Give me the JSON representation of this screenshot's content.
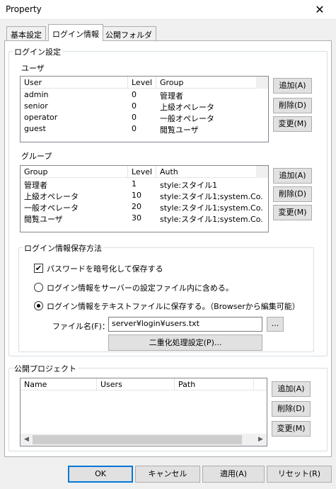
{
  "window": {
    "title": "Property",
    "close_glyph": "✕"
  },
  "tabs": [
    {
      "label": "基本設定"
    },
    {
      "label": "ログイン情報"
    },
    {
      "label": "公開フォルダ"
    }
  ],
  "login_settings": {
    "label": "ログイン設定",
    "users": {
      "label": "ユーザ",
      "columns": [
        "User",
        "Level",
        "Group"
      ],
      "rows": [
        [
          "admin",
          "0",
          "管理者"
        ],
        [
          "senior",
          "0",
          "上級オペレータ"
        ],
        [
          "operator",
          "0",
          "一般オペレータ"
        ],
        [
          "guest",
          "0",
          "閲覧ユーザ"
        ]
      ],
      "buttons": {
        "add": "追加(A)",
        "delete": "削除(D)",
        "change": "変更(M)"
      }
    },
    "groups": {
      "label": "グループ",
      "columns": [
        "Group",
        "Level",
        "Auth"
      ],
      "rows": [
        [
          "管理者",
          "1",
          "style:スタイル1"
        ],
        [
          "上級オペレータ",
          "10",
          "style:スタイル1;system.Co..."
        ],
        [
          "一般オペレータ",
          "20",
          "style:スタイル1;system.Co..."
        ],
        [
          "閲覧ユーザ",
          "30",
          "style:スタイル1;system.Co..."
        ]
      ],
      "buttons": {
        "add": "追加(A)",
        "delete": "削除(D)",
        "change": "変更(M)"
      }
    },
    "save_method": {
      "label": "ログイン情報保存方法",
      "encrypt_label": "パスワードを暗号化して保存する",
      "encrypt_checked": true,
      "option_server": "ログイン情報をサーバーの設定ファイル内に含める。",
      "option_textfile": "ログイン情報をテキストファイルに保存する。（Browserから編集可能）",
      "selected": "textfile",
      "filename_label": "ファイル名(F)：",
      "filename_value": "server¥login¥users.txt",
      "browse_label": "...",
      "duplex_button": "二重化処理設定(P)..."
    }
  },
  "public_projects": {
    "label": "公開プロジェクト",
    "columns": [
      "Name",
      "Users",
      "Path"
    ],
    "rows": [],
    "buttons": {
      "add": "追加(A)",
      "delete": "削除(D)",
      "change": "変更(M)"
    }
  },
  "footer": {
    "ok": "OK",
    "cancel": "キャンセル",
    "apply": "適用(A)",
    "reset": "リセット(R)"
  },
  "colors": {
    "default_button_border": "#0078d7",
    "panel_bg": "#ffffff",
    "window_bg": "#f0f0f0"
  }
}
